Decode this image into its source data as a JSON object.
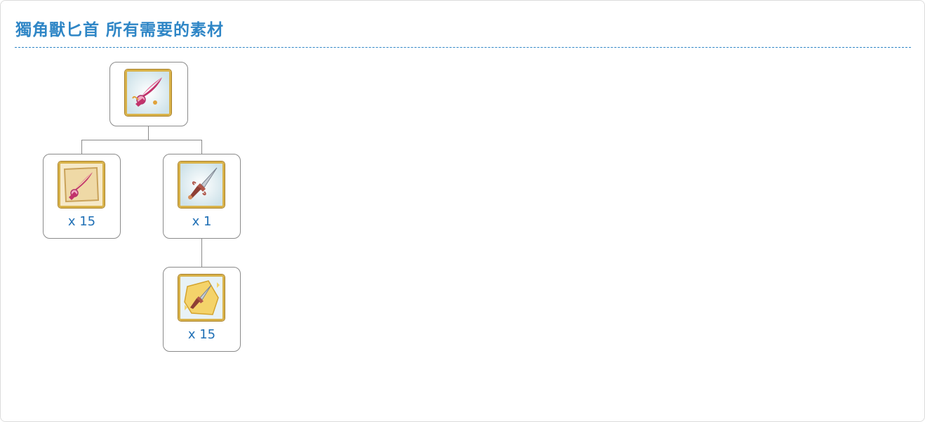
{
  "title": "獨角獸匕首 所有需要的素材",
  "colors": {
    "title": "#2f86c6",
    "quantity": "#1f6fb5",
    "border": "#8a8a8a",
    "icon_frame": "#d8b24a"
  },
  "tree": {
    "root": {
      "icon": "unicorn-dagger-icon"
    },
    "children": [
      {
        "icon": "unicorn-dagger-fragment-icon",
        "quantity": "x 15"
      },
      {
        "icon": "ornate-dagger-icon",
        "quantity": "x 1",
        "children": [
          {
            "icon": "ornate-dagger-fragment-icon",
            "quantity": "x 15"
          }
        ]
      }
    ]
  }
}
